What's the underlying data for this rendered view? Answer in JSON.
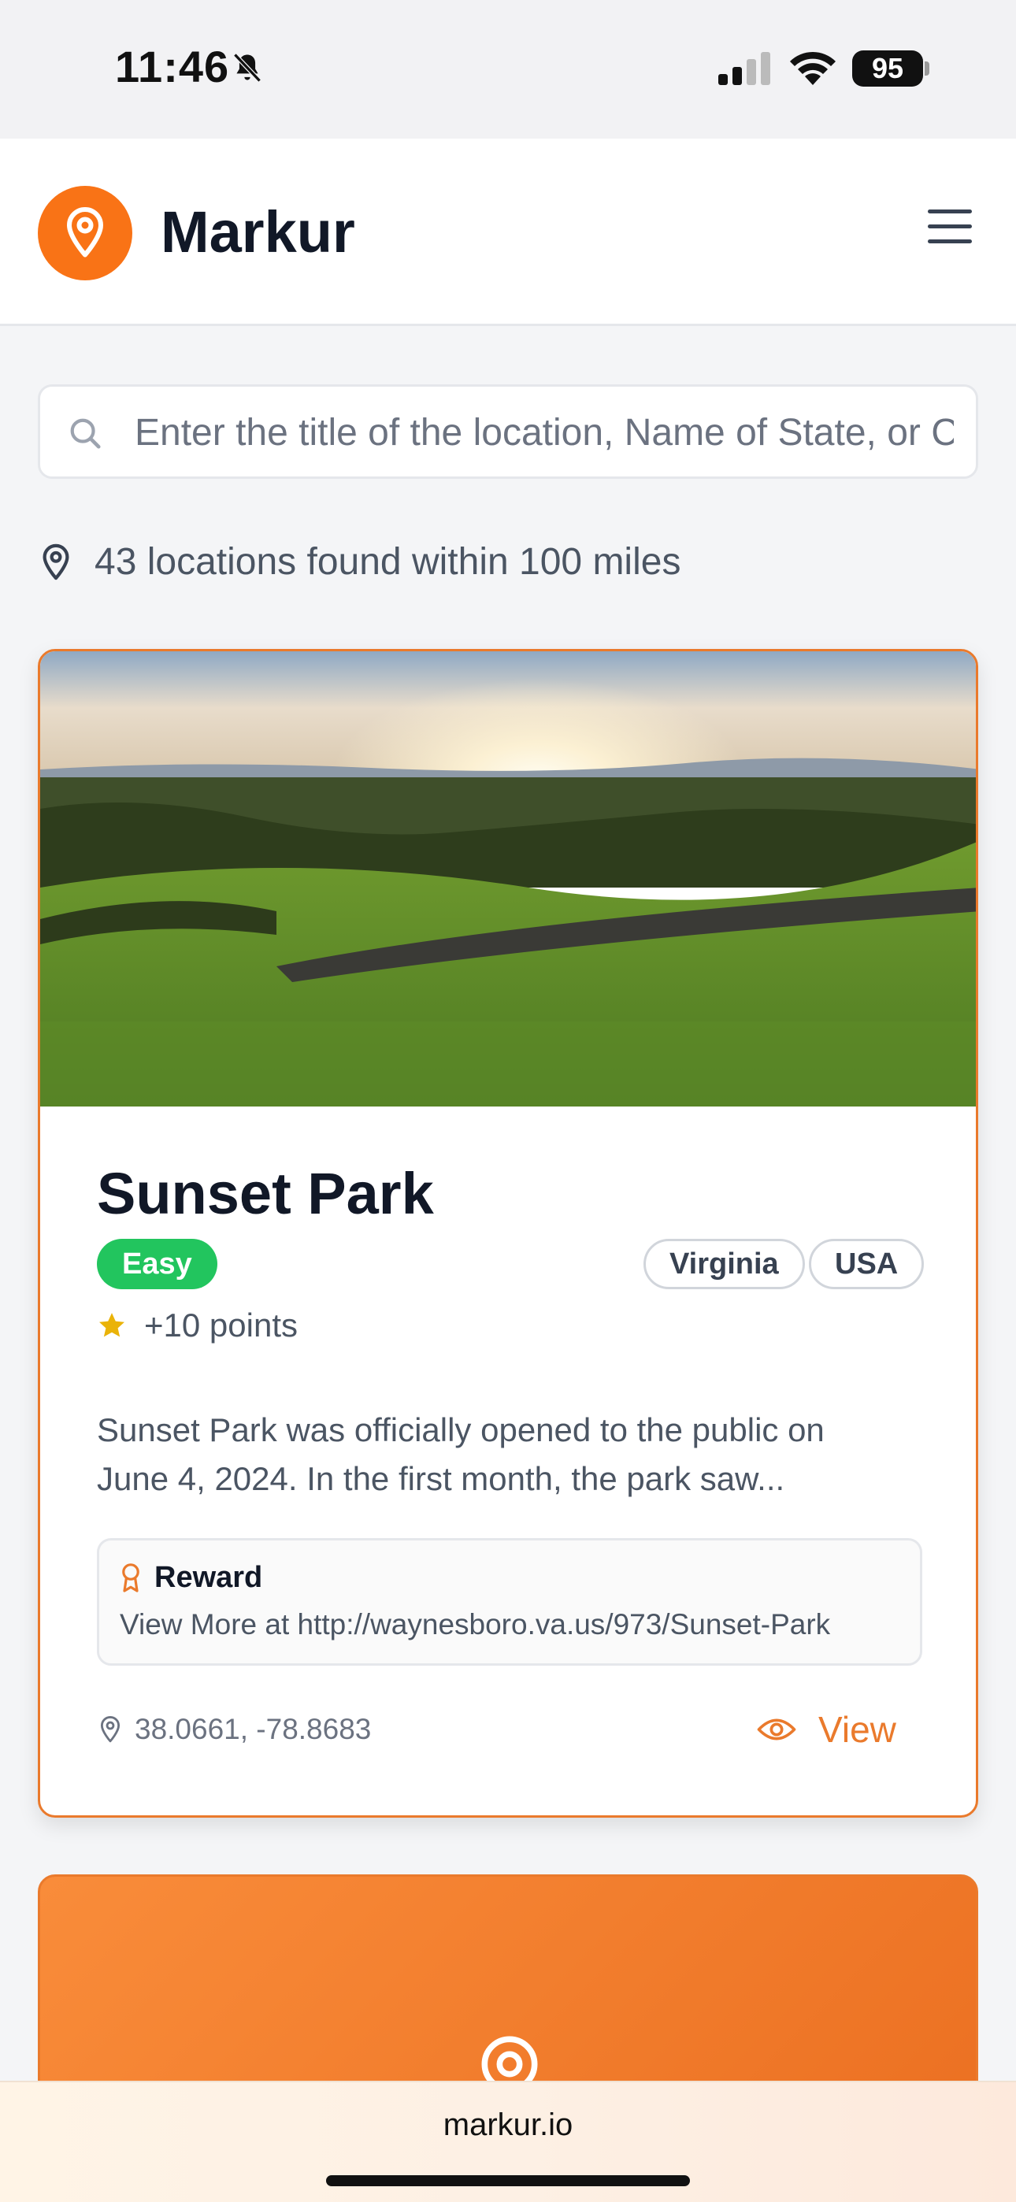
{
  "status_bar": {
    "time": "11:46",
    "battery": "95",
    "icons": [
      "bell-slash-icon",
      "signal-icon",
      "wifi-icon",
      "battery-icon"
    ]
  },
  "header": {
    "brand": "Markur",
    "logo_icon": "map-pin-icon",
    "menu_icon": "hamburger-menu-icon",
    "accent_color": "#f97316"
  },
  "search": {
    "placeholder": "Enter the title of the location, Name of State, or Country",
    "value": ""
  },
  "results": {
    "text": "43 locations found within 100 miles"
  },
  "card": {
    "image_alt": "Sunset over green hills with a town and road in the distance",
    "title": "Sunset Park",
    "difficulty": "Easy",
    "difficulty_color": "#22c55e",
    "tags": [
      "Virginia",
      "USA"
    ],
    "points": "+10 points",
    "description_line1": "Sunset Park was officially opened to the public on",
    "description_line2": "June 4, 2024. In the first month, the park saw...",
    "reward_title": "Reward",
    "reward_text": "View More at http://waynesboro.va.us/973/Sunset-Park",
    "coordinates": "38.0661, -78.8683",
    "view_label": "View"
  },
  "browser": {
    "url": "markur.io"
  }
}
